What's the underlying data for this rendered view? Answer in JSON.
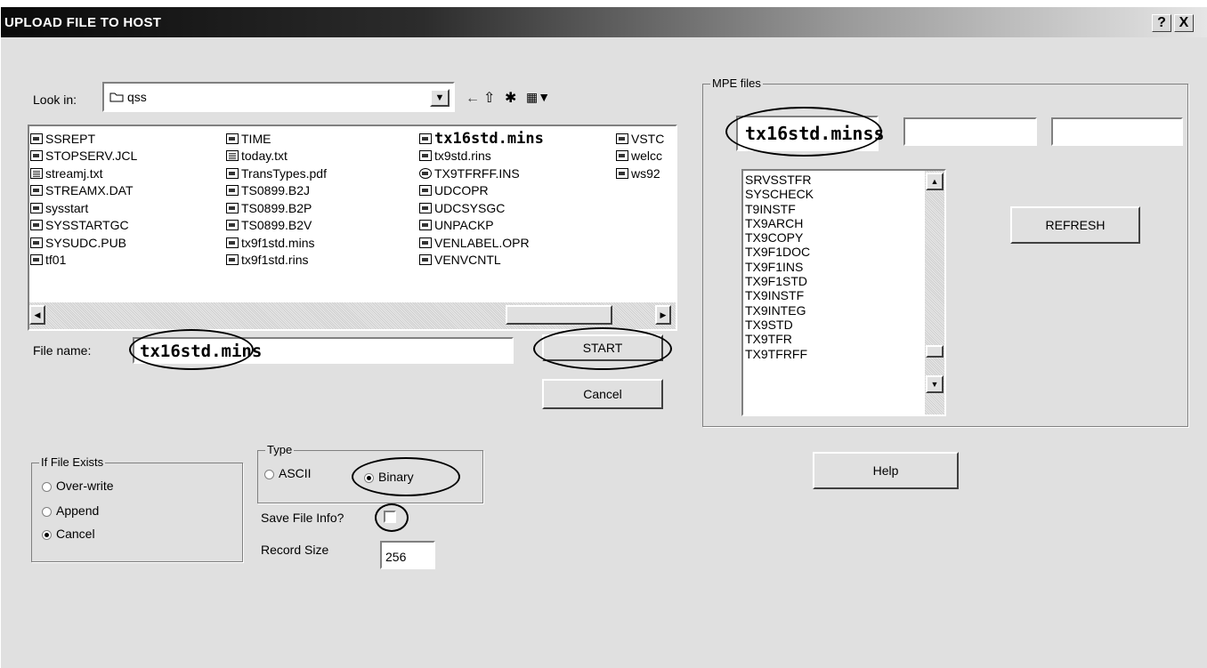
{
  "window": {
    "title": "UPLOAD FILE TO HOST",
    "help_glyph": "?",
    "close_glyph": "X"
  },
  "lookin": {
    "label": "Look in:",
    "value": "qss",
    "dropdown_glyph": "▼"
  },
  "toolbar": {
    "back_glyph": "←",
    "up_glyph": "⇧",
    "newfolder_glyph": "✱",
    "view_glyph": "▦▼"
  },
  "files": {
    "columns": [
      [
        {
          "name": "SSREPT",
          "icon": "exe"
        },
        {
          "name": "STOPSERV.JCL",
          "icon": "exe"
        },
        {
          "name": "streamj.txt",
          "icon": "doc"
        },
        {
          "name": "STREAMX.DAT",
          "icon": "exe"
        },
        {
          "name": "sysstart",
          "icon": "exe"
        },
        {
          "name": "SYSSTARTGC",
          "icon": "exe"
        },
        {
          "name": "SYSUDC.PUB",
          "icon": "exe"
        },
        {
          "name": "tf01",
          "icon": "exe"
        }
      ],
      [
        {
          "name": "TIME",
          "icon": "exe"
        },
        {
          "name": "today.txt",
          "icon": "doc"
        },
        {
          "name": "TransTypes.pdf",
          "icon": "pdf"
        },
        {
          "name": "TS0899.B2J",
          "icon": "exe"
        },
        {
          "name": "TS0899.B2P",
          "icon": "exe"
        },
        {
          "name": "TS0899.B2V",
          "icon": "exe"
        },
        {
          "name": "tx9f1std.mins",
          "icon": "exe"
        },
        {
          "name": "tx9f1std.rins",
          "icon": "exe"
        }
      ],
      [
        {
          "name": "tx16std.mins",
          "icon": "exe",
          "selected": true
        },
        {
          "name": "tx9std.rins",
          "icon": "exe"
        },
        {
          "name": "TX9TFRFF.INS",
          "icon": "globe"
        },
        {
          "name": "UDCOPR",
          "icon": "exe"
        },
        {
          "name": "UDCSYSGC",
          "icon": "exe"
        },
        {
          "name": "UNPACKP",
          "icon": "exe"
        },
        {
          "name": "VENLABEL.OPR",
          "icon": "exe"
        },
        {
          "name": "VENVCNTL",
          "icon": "exe"
        }
      ],
      [
        {
          "name": "VSTC",
          "icon": "exe"
        },
        {
          "name": "welcc",
          "icon": "exe"
        },
        {
          "name": "ws92",
          "icon": "exe"
        }
      ]
    ],
    "scroll_left_glyph": "◀",
    "scroll_right_glyph": "▶"
  },
  "filename": {
    "label": "File name:",
    "value": "tx16std.mins"
  },
  "buttons": {
    "start": "START",
    "cancel": "Cancel",
    "refresh": "REFRESH",
    "help": "Help"
  },
  "mpe": {
    "legend": "MPE files",
    "field1": "tx16std.minss",
    "field2": "",
    "field3": "",
    "items": [
      "SRVSSTFR",
      "SYSCHECK",
      "T9INSTF",
      "TX9ARCH",
      "TX9COPY",
      "TX9F1DOC",
      "TX9F1INS",
      "TX9F1STD",
      "TX9INSTF",
      "TX9INTEG",
      "TX9STD",
      "TX9TFR",
      "TX9TFRFF"
    ],
    "scroll_up_glyph": "▲",
    "scroll_down_glyph": "▼"
  },
  "if_exists": {
    "legend": "If File Exists",
    "options": [
      {
        "label": "Over-write",
        "checked": false
      },
      {
        "label": "Append",
        "checked": false
      },
      {
        "label": "Cancel",
        "checked": true
      }
    ]
  },
  "type": {
    "legend": "Type",
    "options": [
      {
        "label": "ASCII",
        "checked": false
      },
      {
        "label": "Binary",
        "checked": true
      }
    ]
  },
  "save_info": {
    "label": "Save File Info?",
    "checked": false
  },
  "record_size": {
    "label": "Record Size",
    "value": "256"
  }
}
